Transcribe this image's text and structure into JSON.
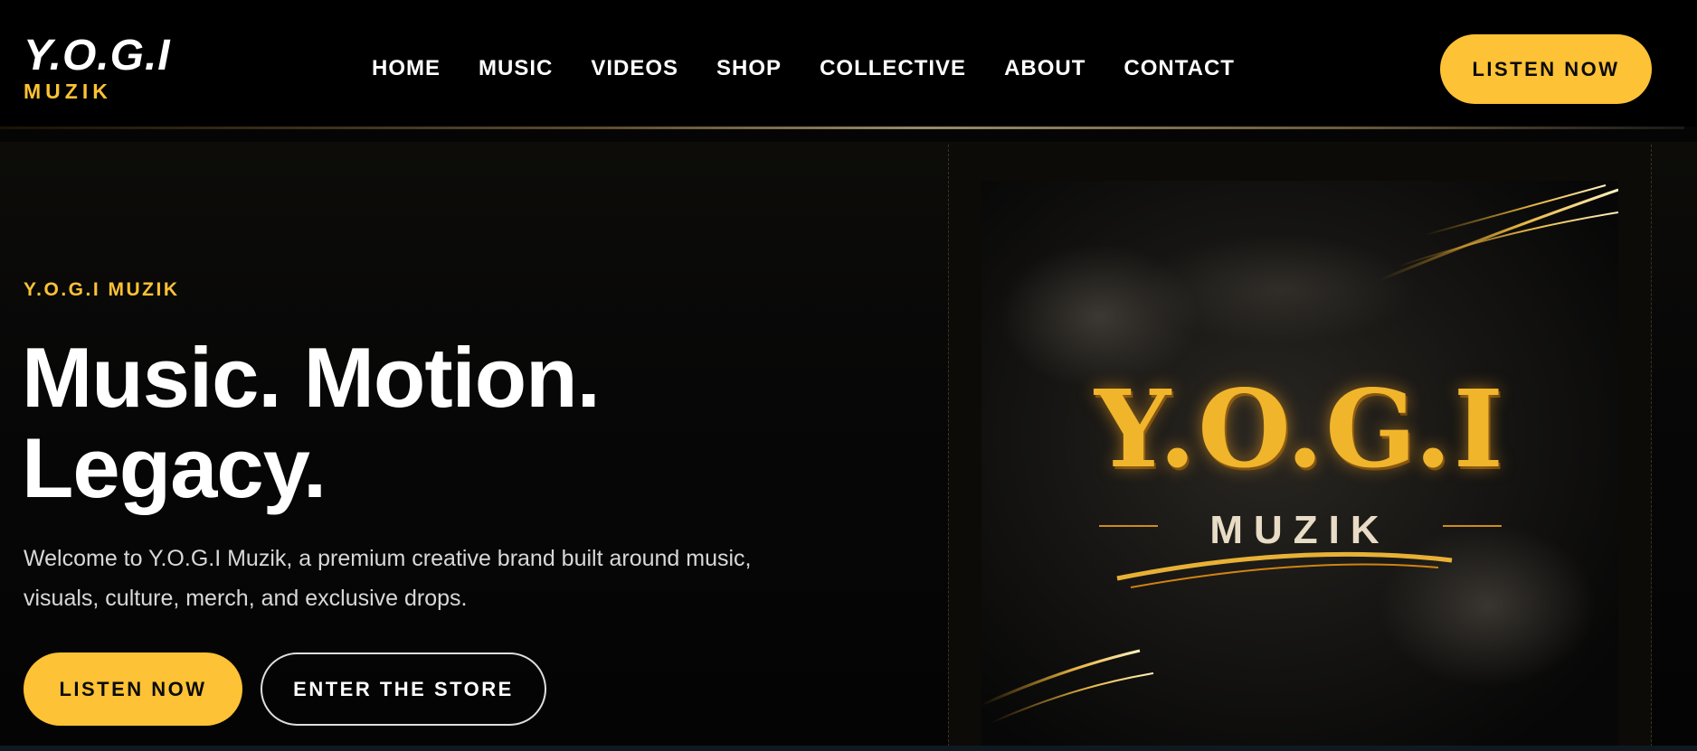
{
  "brand": {
    "logo_main": "Y.O.G.I",
    "logo_sub": "MUZIK",
    "accent_color": "#fdc235",
    "background_color": "#000000"
  },
  "nav": {
    "items": [
      {
        "label": "HOME"
      },
      {
        "label": "MUSIC"
      },
      {
        "label": "VIDEOS"
      },
      {
        "label": "SHOP"
      },
      {
        "label": "COLLECTIVE"
      },
      {
        "label": "ABOUT"
      },
      {
        "label": "CONTACT"
      }
    ],
    "cta_label": "LISTEN NOW"
  },
  "hero": {
    "eyebrow": "Y.O.G.I MUZIK",
    "headline_line1": "Music. Motion.",
    "headline_line2": "Legacy.",
    "intro_line1": "Welcome to Y.O.G.I Muzik, a premium creative brand built around music,",
    "intro_line2": "visuals, culture, merch, and exclusive drops.",
    "primary_button": "LISTEN NOW",
    "secondary_button": "ENTER THE STORE"
  },
  "art": {
    "title": "Y.O.G.I",
    "subtitle": "MUZIK"
  }
}
